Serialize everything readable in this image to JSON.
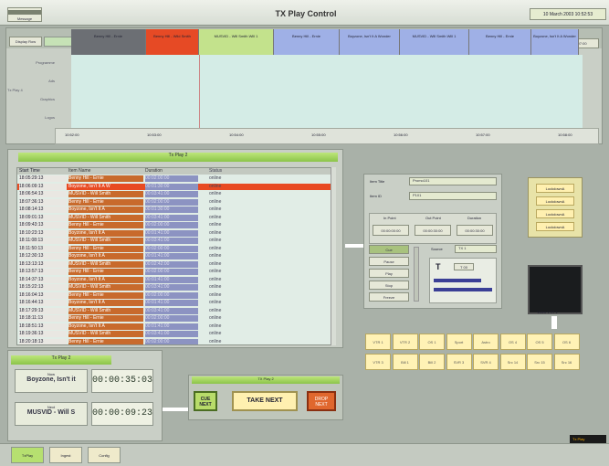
{
  "header": {
    "title": "TX Play Control",
    "message_btn": "Message",
    "clock": "10 March 2003 10:52:53"
  },
  "timeline": {
    "display_btn": "Display Row",
    "next_btn": "Now / Next",
    "zoom_label": "Zoom",
    "zoom_value": "00:00:07:00",
    "row_labels": [
      "Programme",
      "Ads",
      "Tx Play 4",
      "Graphics",
      "Logos"
    ],
    "segments": [
      {
        "label": "Benny Hill - Ernie",
        "color": "#6c6f74"
      },
      {
        "label": "Benny Hill - Wild Smith",
        "color": "#e64a25"
      },
      {
        "label": "MUSVID - Will Smith Will 1",
        "color": "#c3e28c"
      },
      {
        "label": "Benny Hill - Ernie",
        "color": "#9fb0e6"
      },
      {
        "label": "Boyzone, Isn't It A Wonder",
        "color": "#9fb0e6"
      },
      {
        "label": "MUSVID - Will Smith Will 1",
        "color": "#9fb0e6"
      },
      {
        "label": "Benny Hill - Ernie",
        "color": "#9fb0e6"
      },
      {
        "label": "Boyzone, Isn't It A Wonder",
        "color": "#9fb0e6"
      }
    ],
    "ruler_ticks": [
      "10:52:00",
      "10:53:00",
      "10:54:00",
      "10:55:00",
      "10:56:00",
      "10:57:00",
      "10:58:00"
    ]
  },
  "playlist": {
    "title": "Tx Play 2",
    "columns": [
      "Start Time",
      "Item Name",
      "Duration",
      "Status"
    ],
    "rows": [
      {
        "time": "18:05:29:13",
        "name": "Benny Hill - Ernie",
        "dur": "00:02:00:00",
        "status": "online"
      },
      {
        "time": "18:06:09:13",
        "name": "Boyzone, Isn't It A W",
        "dur": "00:01:30:00",
        "status": "online"
      },
      {
        "time": "18:06:54:13",
        "name": "MUSVID - Will Smith",
        "dur": "00:03:41:00",
        "status": "online"
      },
      {
        "time": "18:07:36:13",
        "name": "Benny Hill - Ernie",
        "dur": "00:02:00:00",
        "status": "online"
      },
      {
        "time": "18:08:14:13",
        "name": "Boyzone, Isn't It A",
        "dur": "00:01:30:00",
        "status": "online"
      },
      {
        "time": "18:09:01:13",
        "name": "MUSVID - Will Smith",
        "dur": "00:03:41:00",
        "status": "online"
      },
      {
        "time": "18:09:43:13",
        "name": "Benny Hill - Ernie",
        "dur": "00:02:00:00",
        "status": "online"
      },
      {
        "time": "18:10:23:13",
        "name": "Boyzone, Isn't It A",
        "dur": "00:01:41:00",
        "status": "online"
      },
      {
        "time": "18:11:08:13",
        "name": "MUSVID - Will Smith",
        "dur": "00:03:41:00",
        "status": "online"
      },
      {
        "time": "18:11:50:13",
        "name": "Benny Hill - Ernie",
        "dur": "00:02:00:00",
        "status": "online"
      },
      {
        "time": "18:12:30:13",
        "name": "Boyzone, Isn't It A",
        "dur": "00:01:41:00",
        "status": "online"
      },
      {
        "time": "18:13:13:13",
        "name": "MUSVID - Will Smith",
        "dur": "00:02:42:00",
        "status": "online"
      },
      {
        "time": "18:13:57:13",
        "name": "Benny Hill - Ernie",
        "dur": "00:02:00:00",
        "status": "online"
      },
      {
        "time": "18:14:37:13",
        "name": "Boyzone, Isn't It A",
        "dur": "00:01:41:00",
        "status": "online"
      },
      {
        "time": "18:15:22:13",
        "name": "MUSVID - Will Smith",
        "dur": "00:03:41:00",
        "status": "online"
      },
      {
        "time": "18:16:04:13",
        "name": "Benny Hill - Ernie",
        "dur": "00:02:00:00",
        "status": "online"
      },
      {
        "time": "18:16:44:13",
        "name": "Boyzone, Isn't It A",
        "dur": "00:01:41:00",
        "status": "online"
      },
      {
        "time": "18:17:29:13",
        "name": "MUSVID - Will Smith",
        "dur": "00:03:41:00",
        "status": "online"
      },
      {
        "time": "18:18:11:13",
        "name": "Benny Hill - Ernie",
        "dur": "00:02:00:00",
        "status": "online"
      },
      {
        "time": "18:18:51:13",
        "name": "Boyzone, Isn't It A",
        "dur": "00:01:41:00",
        "status": "online"
      },
      {
        "time": "18:19:36:13",
        "name": "MUSVID - Will Smith",
        "dur": "00:03:41:00",
        "status": "online"
      },
      {
        "time": "18:20:18:13",
        "name": "Benny Hill - Ernie",
        "dur": "00:02:00:00",
        "status": "online"
      }
    ]
  },
  "item": {
    "title_label": "Item Title",
    "title_value": "Promo101",
    "id_label": "Item ID",
    "id_value": "P101",
    "in_label": "In Point",
    "out_label": "Out Point",
    "dur_label": "Duration",
    "in_value": "00:00:00:00",
    "out_value": "00:00:30:00",
    "dur_value": "00:00:30:00",
    "modes": [
      "Cue",
      "Pause",
      "Play",
      "Stop",
      "Freeze"
    ],
    "source_label": "Source",
    "source_value": "TX 1",
    "t_button": "T",
    "t_value": "T 00"
  },
  "lists": {
    "items": [
      "LockdownA",
      "LockdownA",
      "LockdownA",
      "LockdownA"
    ],
    "video_label": "Video VTR 1"
  },
  "grid": {
    "row1": [
      "VTR 1",
      "VTR 2",
      "OS 1",
      "Sport",
      "Astro",
      "OS 4",
      "OS 5",
      "OS 6"
    ],
    "row2": [
      "VTR 3",
      "Bill 1",
      "Bill 2",
      "SVR 3",
      "SVR 4",
      "Src 14",
      "Src 15",
      "Src 16"
    ]
  },
  "tx2": {
    "title": "Tx Play 2",
    "now_label": "Now",
    "now_name": "Boyzone, Isn't it",
    "now_time": "00:00:35:03",
    "next_label": "Next",
    "next_name": "MUSVID - Will S",
    "next_time": "00:00:09:23"
  },
  "tx3": {
    "title": "TX Play 2",
    "cue_next": "CUE NEXT",
    "take_next": "TAKE NEXT",
    "drop_next": "DROP NEXT"
  },
  "tabs": [
    "TxPlay",
    "Ingest",
    "Config"
  ],
  "footer": {
    "corner": "Tx Play"
  }
}
